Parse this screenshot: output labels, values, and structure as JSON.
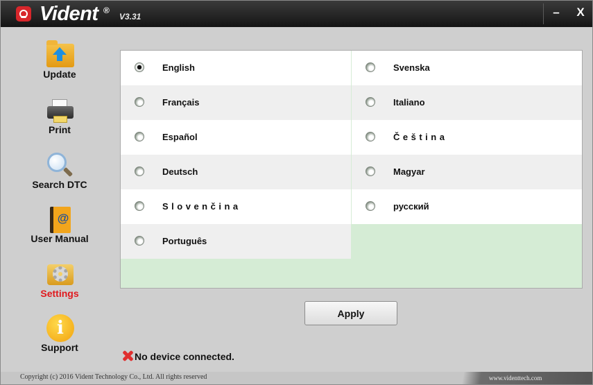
{
  "title_bar": {
    "brand": "Vident",
    "registered": "®",
    "version": "V3.31",
    "minimize_label": "–",
    "close_label": "X"
  },
  "sidebar": {
    "items": [
      {
        "label": "Update",
        "icon": "update-folder-icon"
      },
      {
        "label": "Print",
        "icon": "printer-icon"
      },
      {
        "label": "Search DTC",
        "icon": "magnifier-icon"
      },
      {
        "label": "User Manual",
        "icon": "manual-book-icon"
      },
      {
        "label": "Settings",
        "icon": "settings-gear-icon",
        "active": true
      },
      {
        "label": "Support",
        "icon": "info-icon"
      }
    ],
    "active_color": "#e0191e"
  },
  "languages": {
    "selected": "English",
    "left": [
      "English",
      "Français",
      "Español",
      "Deutsch",
      "S l o v e n č i n a",
      "Português"
    ],
    "right": [
      "Svenska",
      "Italiano",
      "Č e š t i n a",
      "Magyar",
      "русский"
    ]
  },
  "apply_label": "Apply",
  "status": {
    "text": "No device connected.",
    "icon": "red-x-icon"
  },
  "footer": {
    "copyright": "Copyright (c) 2016 Vident Technology Co., Ltd. All rights reserved",
    "website": "www.videnttech.com"
  },
  "colors": {
    "panel_background": "#d5ecd5",
    "titlebar": "#1e1e1e",
    "window_background": "#cfcfcf"
  }
}
